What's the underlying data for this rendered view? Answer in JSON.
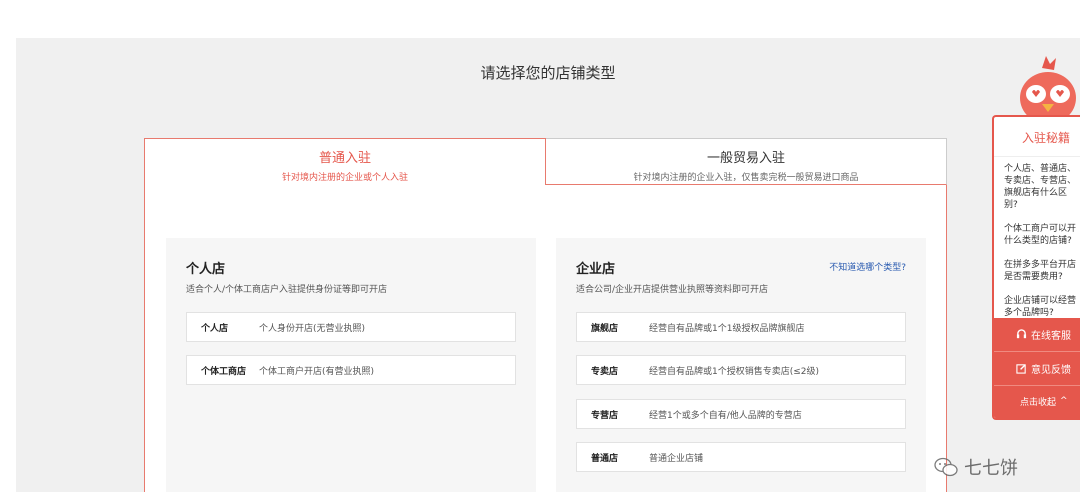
{
  "page": {
    "title": "请选择您的店铺类型"
  },
  "tabs": [
    {
      "label": "普通入驻",
      "sub": "针对境内注册的企业或个人入驻"
    },
    {
      "label": "一般贸易入驻",
      "sub": "针对境内注册的企业入驻，仅售卖完税一般贸易进口商品"
    }
  ],
  "personal": {
    "title": "个人店",
    "desc": "适合个人/个体工商店户入驻提供身份证等即可开店",
    "options": [
      {
        "name": "个人店",
        "info": "个人身份开店(无营业执照)"
      },
      {
        "name": "个体工商店",
        "info": "个体工商户开店(有营业执照)"
      }
    ]
  },
  "enterprise": {
    "title": "企业店",
    "desc": "适合公司/企业开店提供营业执照等资料即可开店",
    "help": "不知道选哪个类型?",
    "options": [
      {
        "name": "旗舰店",
        "info": "经营自有品牌或1个1级授权品牌旗舰店"
      },
      {
        "name": "专卖店",
        "info": "经营自有品牌或1个授权销售专卖店(≤2级)"
      },
      {
        "name": "专营店",
        "info": "经营1个或多个自有/他人品牌的专营店"
      },
      {
        "name": "普通店",
        "info": "普通企业店铺"
      }
    ]
  },
  "sidebar": {
    "title": "入驻秘籍",
    "faqs": [
      [
        "个人店、普通店、",
        "专卖店、专营店、",
        "旗舰店有什么区",
        "别?"
      ],
      [
        "个体工商户可以开",
        "什么类型的店铺?"
      ],
      [
        "在拼多多平台开店",
        "是否需要费用?"
      ],
      [
        "企业店铺可以经营",
        "多个品牌吗?"
      ]
    ],
    "service": "在线客服",
    "feedback": "意见反馈",
    "collapse": "点击收起"
  },
  "watermark": {
    "text": "七七饼"
  },
  "colors": {
    "accent": "#e5574c",
    "link": "#2a5bb0"
  }
}
